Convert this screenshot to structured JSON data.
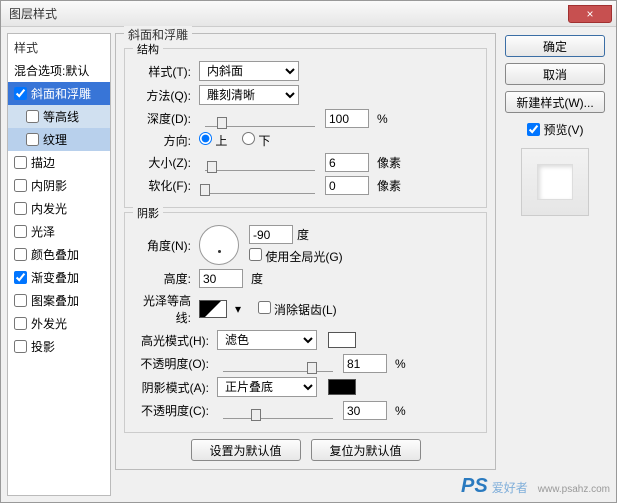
{
  "window": {
    "title": "图层样式",
    "close": "×"
  },
  "left": {
    "header": "样式",
    "blend": "混合选项:默认",
    "items": [
      {
        "label": "斜面和浮雕",
        "checked": true,
        "sel": true
      },
      {
        "label": "等高线",
        "sub": true,
        "checked": false
      },
      {
        "label": "纹理",
        "sub": true,
        "checked": false,
        "hl": true
      },
      {
        "label": "描边",
        "checked": false
      },
      {
        "label": "内阴影",
        "checked": false
      },
      {
        "label": "内发光",
        "checked": false
      },
      {
        "label": "光泽",
        "checked": false
      },
      {
        "label": "颜色叠加",
        "checked": false
      },
      {
        "label": "渐变叠加",
        "checked": true
      },
      {
        "label": "图案叠加",
        "checked": false
      },
      {
        "label": "外发光",
        "checked": false
      },
      {
        "label": "投影",
        "checked": false
      }
    ]
  },
  "bevel": {
    "group": "斜面和浮雕",
    "structure": "结构",
    "style_l": "样式(T):",
    "style_v": "内斜面",
    "tech_l": "方法(Q):",
    "tech_v": "雕刻清晰",
    "depth_l": "深度(D):",
    "depth_v": "100",
    "depth_u": "%",
    "dir_l": "方向:",
    "dir_up": "上",
    "dir_down": "下",
    "size_l": "大小(Z):",
    "size_v": "6",
    "size_u": "像素",
    "soft_l": "软化(F):",
    "soft_v": "0",
    "soft_u": "像素"
  },
  "shade": {
    "group": "阴影",
    "angle_l": "角度(N):",
    "angle_v": "-90",
    "angle_u": "度",
    "global": "使用全局光(G)",
    "alt_l": "高度:",
    "alt_v": "30",
    "alt_u": "度",
    "gloss_l": "光泽等高线:",
    "anti": "消除锯齿(L)",
    "hi_l": "高光模式(H):",
    "hi_v": "滤色",
    "hi_color": "#ffffff",
    "hiop_l": "不透明度(O):",
    "hiop_v": "81",
    "pct": "%",
    "sh_l": "阴影模式(A):",
    "sh_v": "正片叠底",
    "sh_color": "#000000",
    "shop_l": "不透明度(C):",
    "shop_v": "30"
  },
  "btm": {
    "def": "设置为默认值",
    "reset": "复位为默认值"
  },
  "right": {
    "ok": "确定",
    "cancel": "取消",
    "new": "新建样式(W)...",
    "preview": "预览(V)"
  },
  "wm": {
    "ps": "PS",
    "txt": "爱好者",
    "url": "www.psahz.com"
  }
}
